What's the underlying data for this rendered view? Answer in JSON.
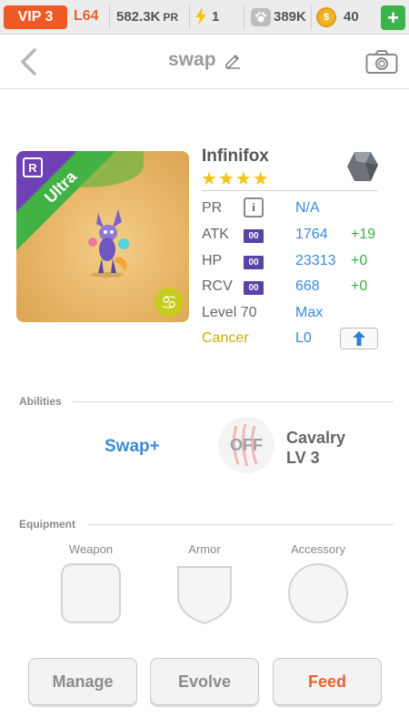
{
  "status_bar": {
    "vip": "VIP 3",
    "level": "L64",
    "pr_value": "582.3K",
    "pr_unit": "PR",
    "energy": "1",
    "paws": "389K",
    "coins": "40",
    "plus": "+"
  },
  "header": {
    "title": "swap"
  },
  "monster": {
    "rarity_badge": "R",
    "ribbon": "Ultra",
    "name": "Infinifox",
    "stars": "★★★★",
    "zodiac_glyph": "♋",
    "stats": [
      {
        "label": "PR",
        "value": "N/A",
        "bonus": ""
      },
      {
        "label": "ATK",
        "badge": "00",
        "value": "1764",
        "bonus": "+19"
      },
      {
        "label": "HP",
        "badge": "00",
        "value": "23313",
        "bonus": "+0"
      },
      {
        "label": "RCV",
        "badge": "00",
        "value": "668",
        "bonus": "+0"
      }
    ],
    "level_label": "Level 70",
    "level_value": "Max",
    "sign_label": "Cancer",
    "sign_value": "L0",
    "colors": {
      "value": "#3c8ad6",
      "bonus": "#3cad43",
      "sign": "#c6b10c"
    }
  },
  "abilities": {
    "section": "Abilities",
    "skill": "Swap+",
    "leader_state": "OFF",
    "leader_name_line1": "Cavalry",
    "leader_name_line2": "LV 3"
  },
  "equipment": {
    "section": "Equipment",
    "slots": [
      "Weapon",
      "Armor",
      "Accessory"
    ]
  },
  "buttons": {
    "manage": "Manage",
    "evolve": "Evolve",
    "feed": "Feed"
  }
}
